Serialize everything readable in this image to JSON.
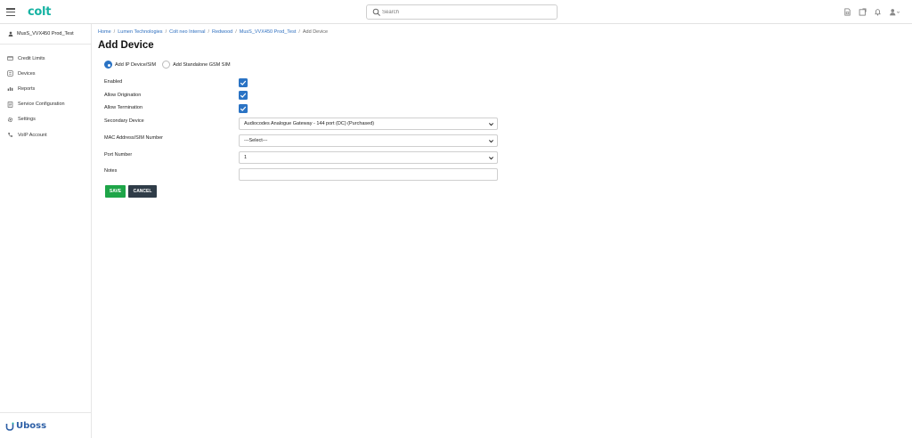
{
  "app": {
    "logo_text": "colt",
    "brand_text": "Uboss",
    "accent_color": "#17b3a3",
    "link_color": "#2e6fbf"
  },
  "topbar": {
    "search_placeholder": "Search",
    "icons": [
      "sim-icon",
      "window-icon",
      "bell-icon",
      "user-icon"
    ]
  },
  "sidebar": {
    "user_name": "MusS_VVX450 Prod_Test",
    "items": [
      {
        "label": "Credit Limits",
        "icon": "credit-card-icon"
      },
      {
        "label": "Devices",
        "icon": "device-icon"
      },
      {
        "label": "Reports",
        "icon": "reports-icon"
      },
      {
        "label": "Service Configuration",
        "icon": "service-config-icon"
      },
      {
        "label": "Settings",
        "icon": "gear-icon"
      },
      {
        "label": "VoIP Account",
        "icon": "voip-icon"
      }
    ]
  },
  "breadcrumb": {
    "items": [
      "Home",
      "Lumen Technologies",
      "Colt neo Internal",
      "Redwood",
      "MusS_VVX450 Prod_Test"
    ],
    "current": "Add Device"
  },
  "page": {
    "title": "Add Device"
  },
  "form": {
    "radio_options": [
      {
        "label": "Add IP Device/SIM",
        "checked": true
      },
      {
        "label": "Add Standalone GSM SIM",
        "checked": false
      }
    ],
    "enabled_label": "Enabled",
    "allow_origination_label": "Allow Origination",
    "allow_termination_label": "Allow Termination",
    "enabled": true,
    "allow_origination": true,
    "allow_termination": true,
    "secondary_device_label": "Secondary Device",
    "secondary_device_value": "Audiocodes Analogue Gateway - 144 port (DC) (Purchased)",
    "mac_label": "MAC Address/SIM Number",
    "mac_value": "---Select---",
    "port_label": "Port Number",
    "port_value": "1",
    "notes_label": "Notes",
    "notes_value": "",
    "save_label": "SAVE",
    "cancel_label": "CANCEL"
  }
}
